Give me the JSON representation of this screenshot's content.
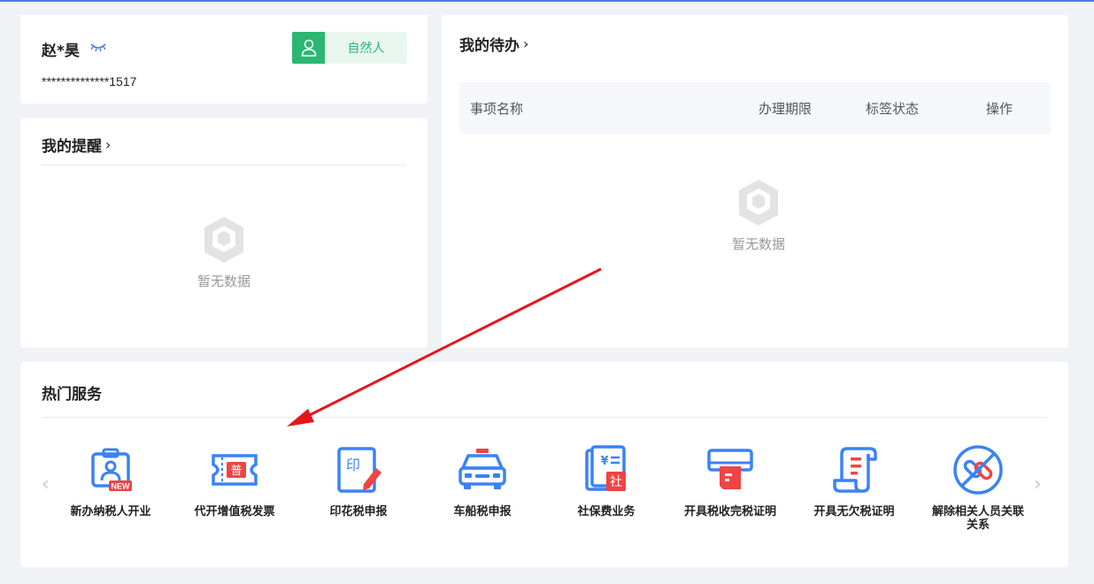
{
  "user": {
    "name": "赵*昊",
    "id_masked": "**************1517",
    "role": "自然人"
  },
  "reminder": {
    "title": "我的提醒",
    "empty_text": "暂无数据"
  },
  "todo": {
    "title": "我的待办",
    "columns": [
      "事项名称",
      "办理期限",
      "标签状态",
      "操作"
    ],
    "empty_text": "暂无数据"
  },
  "hot": {
    "title": "热门服务",
    "services": [
      {
        "label": "新办纳税人开业",
        "icon": "new-taxpayer-icon"
      },
      {
        "label": "代开增值税发票",
        "icon": "invoice-ticket-icon"
      },
      {
        "label": "印花税申报",
        "icon": "stamp-tax-icon"
      },
      {
        "label": "车船税申报",
        "icon": "vehicle-tax-icon"
      },
      {
        "label": "社保费业务",
        "icon": "social-insurance-icon"
      },
      {
        "label": "开具税收完税证明",
        "icon": "tax-certificate-printer-icon"
      },
      {
        "label": "开具无欠税证明",
        "icon": "no-arrears-certificate-icon"
      },
      {
        "label": "解除相关人员关联关系",
        "icon": "unlink-relation-icon"
      }
    ]
  },
  "colors": {
    "accent_blue": "#3b82f6",
    "accent_red": "#ef4444",
    "role_green": "#2bb673",
    "annotation_arrow": "#e5161b"
  }
}
